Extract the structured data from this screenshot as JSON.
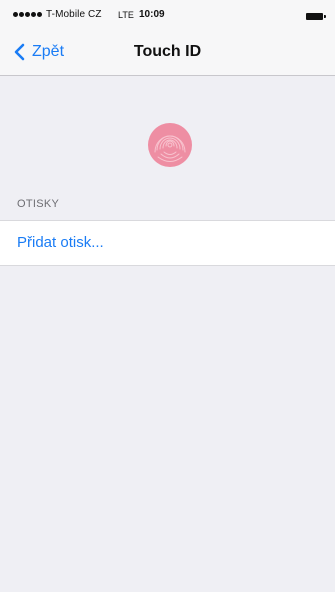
{
  "status_bar": {
    "carrier": "T-Mobile CZ",
    "network": "LTE",
    "time": "10:09",
    "signal_bars": 5,
    "signal_icon": "signal-dots-icon",
    "battery_icon": "battery-icon"
  },
  "nav": {
    "back_label": "Zpět",
    "back_icon": "chevron-left-icon",
    "title": "Touch ID"
  },
  "hero": {
    "icon": "fingerprint-icon",
    "color": "#e9738f"
  },
  "section": {
    "header": "OTISKY",
    "items": [
      {
        "label": "Přidat otisk..."
      }
    ]
  },
  "colors": {
    "accent": "#1a7cf5",
    "background": "#efeff4",
    "bar": "#f7f7f8"
  }
}
